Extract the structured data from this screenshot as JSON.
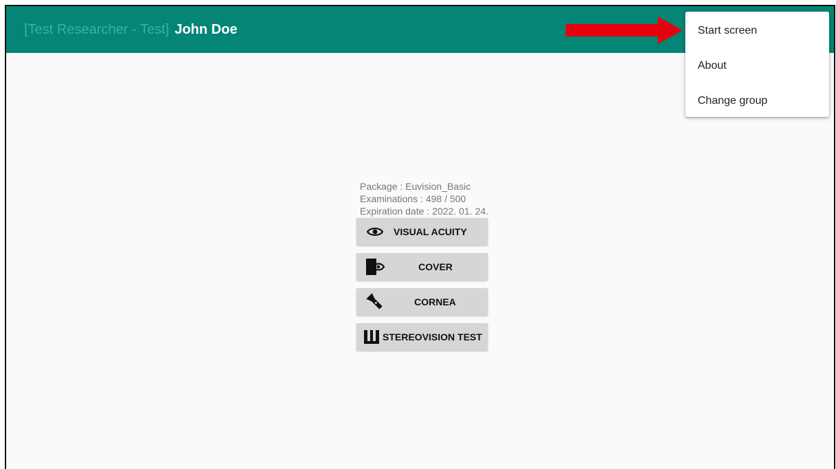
{
  "appbar": {
    "prefix": "[Test Researcher  - Test]",
    "user_name": "John Doe",
    "background": "#048575"
  },
  "menu": {
    "items": [
      {
        "label": "Start screen"
      },
      {
        "label": "About"
      },
      {
        "label": "Change group"
      }
    ]
  },
  "annotation": {
    "icon": "red-arrow",
    "color": "#e8000f"
  },
  "info": {
    "package": "Package : Euvision_Basic",
    "examinations": "Examinations : 498 / 500",
    "expiration": "Expiration date : 2022. 01. 24."
  },
  "buttons": [
    {
      "label": "VISUAL ACUITY",
      "icon": "eye-icon"
    },
    {
      "label": "COVER",
      "icon": "cover-eye-icon"
    },
    {
      "label": "CORNEA",
      "icon": "flashlight-icon"
    },
    {
      "label": "STEREOVISION TEST",
      "icon": "stereo-bars-icon"
    }
  ]
}
